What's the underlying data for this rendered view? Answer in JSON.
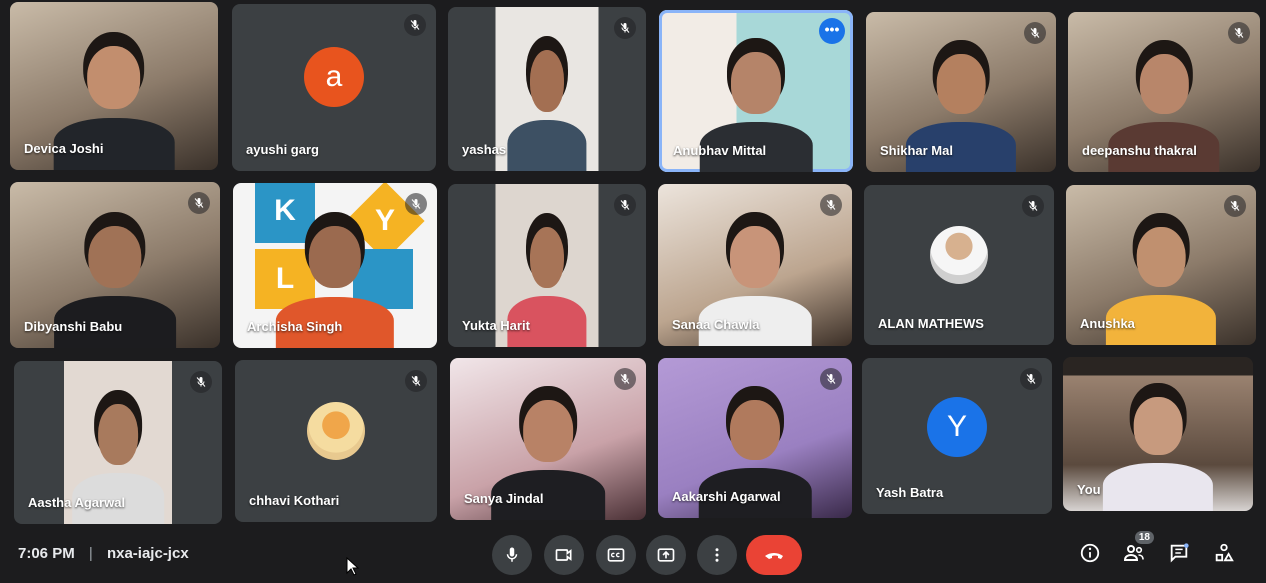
{
  "participants": [
    {
      "name": "Devica Joshi"
    },
    {
      "name": "ayushi garg",
      "initial": "a",
      "color": "#e8541e"
    },
    {
      "name": "yashas"
    },
    {
      "name": "Anubhav Mittal"
    },
    {
      "name": "Shikhar Mal"
    },
    {
      "name": "deepanshu thakral"
    },
    {
      "name": "Dibyanshi Babu"
    },
    {
      "name": "Archisha Singh"
    },
    {
      "name": "Yukta Harit"
    },
    {
      "name": "Sanaa Chawla"
    },
    {
      "name": "ALAN MATHEWS"
    },
    {
      "name": "Anushka"
    },
    {
      "name": "Aastha Agarwal"
    },
    {
      "name": "chhavi Kothari"
    },
    {
      "name": "Sanya Jindal"
    },
    {
      "name": "Aakarshi Agarwal"
    },
    {
      "name": "Yash Batra",
      "initial": "Y",
      "color": "#1a73e8"
    },
    {
      "name": "You"
    }
  ],
  "kyl_letters": [
    "K",
    "Y",
    "L"
  ],
  "meeting": {
    "time": "7:06 PM",
    "code": "nxa-iajc-jcx"
  },
  "people_count": "18",
  "more_glyph": "•••",
  "colors": {
    "end_call": "#ea4335",
    "active_outline": "#8ab4f8",
    "more_button": "#1a73e8"
  }
}
